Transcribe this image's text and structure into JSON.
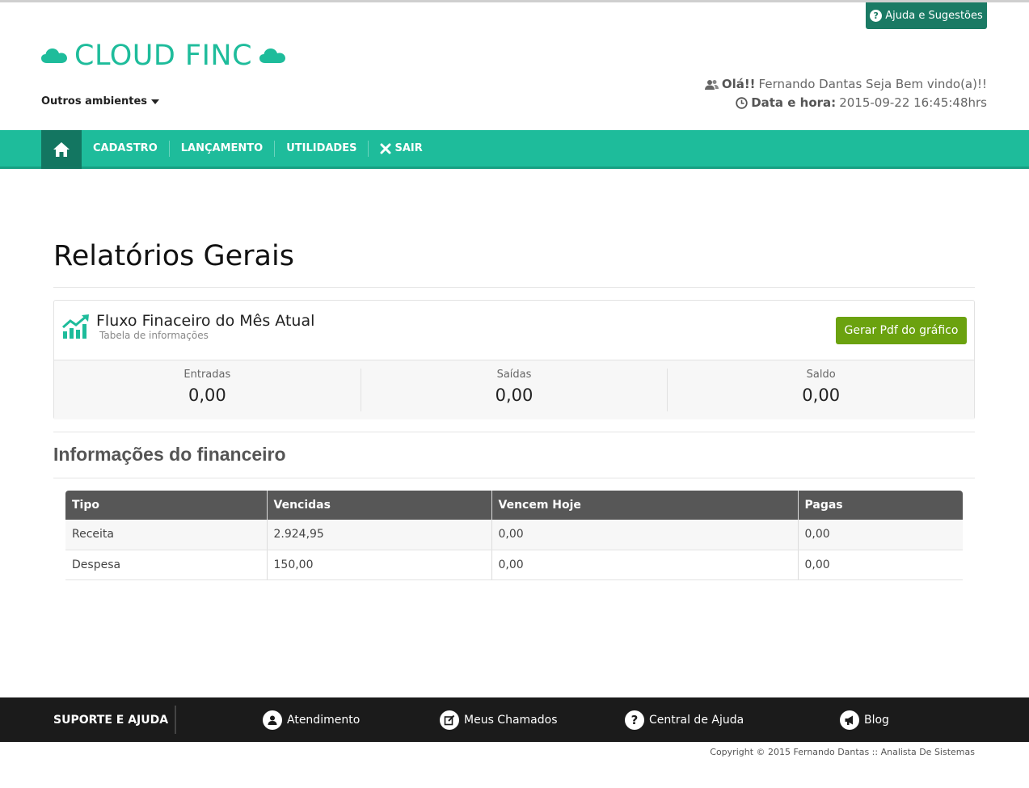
{
  "header": {
    "help_label": "Ajuda e Sugestões",
    "logo_text": "CLOUD FINC",
    "other_envs": "Outros ambientes",
    "greet_bold": "Olá!!",
    "greet_text": "Fernando Dantas Seja Bem vindo(a)!!",
    "datetime_label": "Data e hora:",
    "datetime_value": "2015-09-22 16:45:48hrs"
  },
  "nav": {
    "items": [
      {
        "label": "CADASTRO"
      },
      {
        "label": "LANÇAMENTO"
      },
      {
        "label": "UTILIDADES"
      },
      {
        "label": "SAIR"
      }
    ]
  },
  "page": {
    "title": "Relatórios Gerais"
  },
  "panel": {
    "title": "Fluxo Finaceiro do Mês Atual",
    "subtitle": "Tabela de informações",
    "pdf_button": "Gerar Pdf do gráfico",
    "stats": [
      {
        "label": "Entradas",
        "value": "0,00"
      },
      {
        "label": "Saídas",
        "value": "0,00"
      },
      {
        "label": "Saldo",
        "value": "0,00"
      }
    ]
  },
  "finance": {
    "title": "Informações do financeiro",
    "columns": [
      "Tipo",
      "Vencidas",
      "Vencem Hoje",
      "Pagas"
    ],
    "rows": [
      [
        "Receita",
        "2.924,95",
        "0,00",
        "0,00"
      ],
      [
        "Despesa",
        "150,00",
        "0,00",
        "0,00"
      ]
    ]
  },
  "footer": {
    "support_label": "SUPORTE E AJUDA",
    "links": [
      {
        "label": "Atendimento",
        "icon": "user-icon"
      },
      {
        "label": "Meus Chamados",
        "icon": "edit-icon"
      },
      {
        "label": "Central de Ajuda",
        "icon": "question-icon"
      },
      {
        "label": "Blog",
        "icon": "megaphone-icon"
      }
    ],
    "copyright": "Copyright © 2015 Fernando Dantas :: Analista De Sistemas"
  },
  "colors": {
    "brand": "#1ebc9b",
    "nav_active": "#137661",
    "pdf_button": "#6ba20f",
    "footer": "#1b1b1b"
  }
}
